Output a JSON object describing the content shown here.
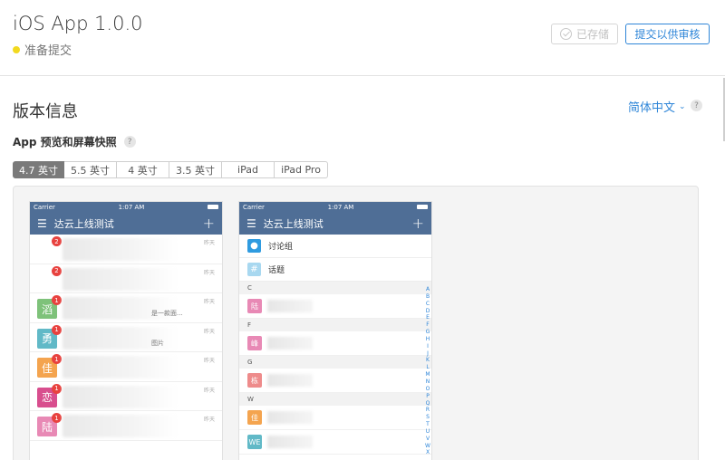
{
  "header": {
    "app_title": "iOS App 1.0.0",
    "status_text": "准备提交",
    "status_color": "#f2d91f",
    "saved_label": "已存储",
    "submit_label": "提交以供审核"
  },
  "version_section": {
    "title": "版本信息",
    "language": "简体中文",
    "help": "?"
  },
  "screenshots": {
    "title": "App 预览和屏幕快照",
    "help": "?",
    "tabs": [
      {
        "label": "4.7 英寸",
        "active": true
      },
      {
        "label": "5.5 英寸",
        "active": false
      },
      {
        "label": "4 英寸",
        "active": false
      },
      {
        "label": "3.5 英寸",
        "active": false
      },
      {
        "label": "iPad",
        "active": false
      },
      {
        "label": "iPad Pro",
        "active": false
      }
    ]
  },
  "phone1": {
    "carrier": "Carrier",
    "time": "1:07 AM",
    "nav_title": "达云上线测试",
    "rows": [
      {
        "avatar": "",
        "avatar_type": "grid",
        "badge": "2",
        "time": "昨天",
        "snippet": ""
      },
      {
        "avatar": "",
        "avatar_type": "grid",
        "badge": "2",
        "time": "昨天",
        "snippet": ""
      },
      {
        "avatar": "滔",
        "color": "#7ec27a",
        "badge": "1",
        "time": "昨天",
        "snippet": "是一款面..."
      },
      {
        "avatar": "勇",
        "color": "#61b9c7",
        "badge": "1",
        "time": "昨天",
        "snippet": "图片"
      },
      {
        "avatar": "佳",
        "color": "#f4a44f",
        "badge": "1",
        "time": "昨天",
        "snippet": ""
      },
      {
        "avatar": "恋",
        "color": "#d84e8e",
        "badge": "1",
        "time": "昨天",
        "snippet": ""
      },
      {
        "avatar": "陆",
        "color": "#e889b5",
        "badge": "1",
        "time": "昨天",
        "snippet": ""
      }
    ]
  },
  "phone2": {
    "carrier": "Carrier",
    "time": "1:07 AM",
    "nav_title": "达云上线测试",
    "discussion": "讨论组",
    "topic": "话题",
    "sections": [
      {
        "letter": "C",
        "avatar": "陆",
        "color": "#e889b5"
      },
      {
        "letter": "F",
        "avatar": "峰",
        "color": "#e889b5"
      },
      {
        "letter": "G",
        "avatar": "栋",
        "color": "#ee8b8b"
      },
      {
        "letter": "W",
        "avatar": "佳",
        "color": "#f4a44f"
      }
    ],
    "extra_row": {
      "avatar": "WE",
      "color": "#61b9c7"
    },
    "index": [
      "A",
      "B",
      "C",
      "D",
      "E",
      "F",
      "G",
      "H",
      "I",
      "J",
      "K",
      "L",
      "M",
      "N",
      "O",
      "P",
      "Q",
      "R",
      "S",
      "T",
      "U",
      "V",
      "W",
      "X"
    ]
  }
}
